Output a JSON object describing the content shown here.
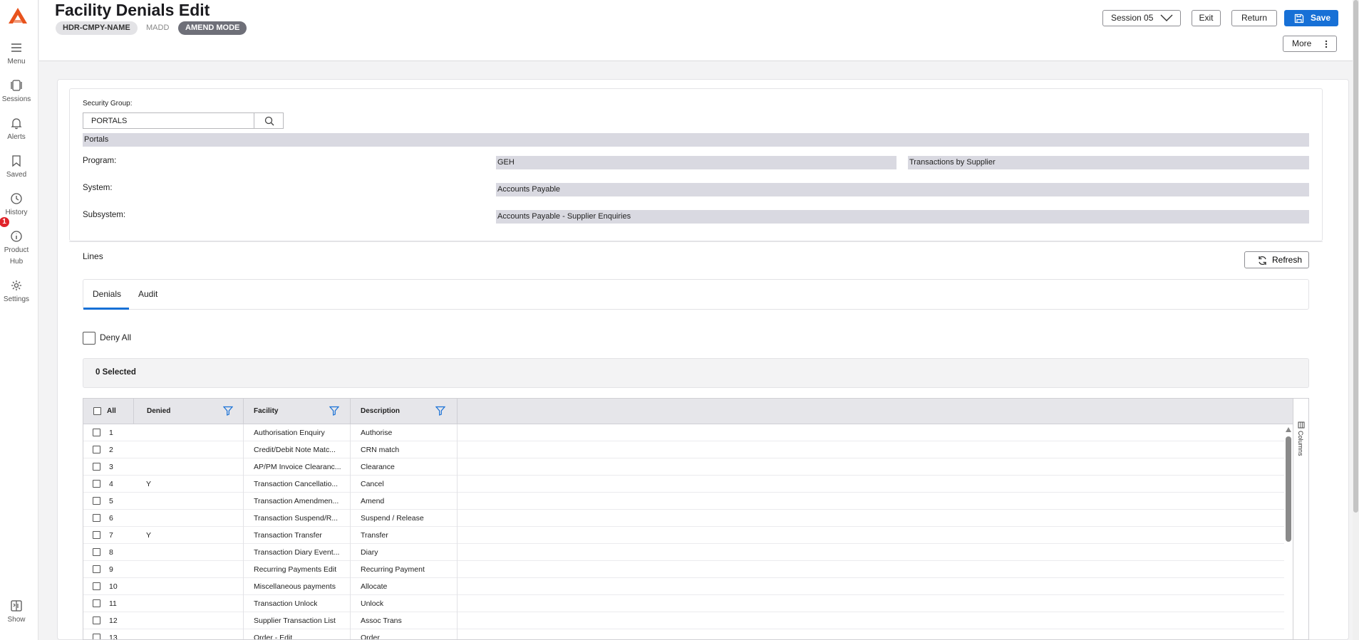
{
  "app": {
    "colors": {
      "accent": "#1770d6",
      "logo": "#e8531d",
      "badge": "#e0242b",
      "amend_chip": "#6e6f78",
      "field_bg": "#d9d9e1"
    }
  },
  "sidebar": {
    "items": [
      {
        "label": "Menu",
        "icon": "hamburger-icon"
      },
      {
        "label": "Sessions",
        "icon": "sessions-icon"
      },
      {
        "label": "Alerts",
        "icon": "bell-icon"
      },
      {
        "label": "Saved",
        "icon": "bookmark-icon"
      },
      {
        "label": "History",
        "icon": "clock-icon"
      },
      {
        "label": "Product",
        "label2": "Hub",
        "icon": "info-icon"
      },
      {
        "label": "Settings",
        "icon": "gear-icon"
      },
      {
        "label": "Show",
        "icon": "show-panel-icon"
      }
    ],
    "badge_count": "1"
  },
  "header": {
    "title": "Facility Denials Edit",
    "chips": {
      "hdr": "HDR-CMPY-NAME",
      "madd": "MADD",
      "mode": "AMEND MODE"
    },
    "session": "Session 05",
    "exit": "Exit",
    "return": "Return",
    "save": "Save",
    "more": "More"
  },
  "form": {
    "security_group_label": "Security Group:",
    "security_group_value": "PORTALS",
    "security_group_desc": "Portals",
    "program_label": "Program:",
    "program_code": "GEH",
    "program_desc": "Transactions by Supplier",
    "system_label": "System:",
    "system_value": "Accounts Payable",
    "subsystem_label": "Subsystem:",
    "subsystem_value": "Accounts Payable - Supplier Enquiries"
  },
  "lines": {
    "title": "Lines",
    "refresh": "Refresh",
    "tabs": [
      "Denials",
      "Audit"
    ],
    "deny_all": "Deny All",
    "selected": "0 Selected",
    "columns_label": "Columns",
    "headers": {
      "all": "All",
      "denied": "Denied",
      "facility": "Facility",
      "description": "Description"
    },
    "rows": [
      {
        "num": "1",
        "denied": "",
        "facility": "Authorisation Enquiry",
        "description": "Authorise"
      },
      {
        "num": "2",
        "denied": "",
        "facility": "Credit/Debit Note Matc...",
        "description": "CRN match"
      },
      {
        "num": "3",
        "denied": "",
        "facility": "AP/PM Invoice Clearanc...",
        "description": "Clearance"
      },
      {
        "num": "4",
        "denied": "Y",
        "facility": "Transaction Cancellatio...",
        "description": "Cancel"
      },
      {
        "num": "5",
        "denied": "",
        "facility": "Transaction Amendmen...",
        "description": "Amend"
      },
      {
        "num": "6",
        "denied": "",
        "facility": "Transaction Suspend/R...",
        "description": "Suspend / Release"
      },
      {
        "num": "7",
        "denied": "Y",
        "facility": "Transaction Transfer",
        "description": "Transfer"
      },
      {
        "num": "8",
        "denied": "",
        "facility": "Transaction Diary Event...",
        "description": "Diary"
      },
      {
        "num": "9",
        "denied": "",
        "facility": "Recurring Payments Edit",
        "description": "Recurring Payment"
      },
      {
        "num": "10",
        "denied": "",
        "facility": "Miscellaneous payments",
        "description": "Allocate"
      },
      {
        "num": "11",
        "denied": "",
        "facility": "Transaction Unlock",
        "description": "Unlock"
      },
      {
        "num": "12",
        "denied": "",
        "facility": "Supplier Transaction List",
        "description": "Assoc Trans"
      },
      {
        "num": "13",
        "denied": "",
        "facility": "Order - Edit",
        "description": "Order"
      }
    ]
  }
}
